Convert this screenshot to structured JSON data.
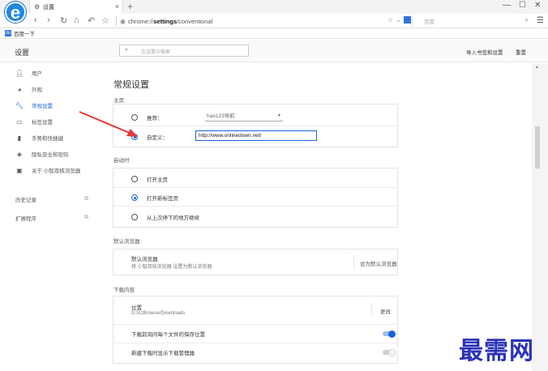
{
  "browser": {
    "tab_title": "设置",
    "new_tab": "+",
    "url_prefix": "chrome://",
    "url_bold": "settings",
    "url_suffix": "/conventional",
    "search_placeholder": "百度",
    "bookmark_label": "百度一下",
    "window_controls": [
      "—",
      "☐",
      "✕"
    ]
  },
  "header": {
    "title": "设置",
    "search_placeholder": "在设置中搜索",
    "import_link": "导入书签和设置",
    "reset_link": "重置"
  },
  "sidebar": {
    "items": [
      {
        "label": "用户",
        "icon": "person-icon"
      },
      {
        "label": "外观",
        "icon": "palette-icon"
      },
      {
        "label": "常规设置",
        "icon": "wrench-icon",
        "active": true
      },
      {
        "label": "标签设置",
        "icon": "tab-icon"
      },
      {
        "label": "手势和快捷键",
        "icon": "mouse-icon"
      },
      {
        "label": "隐私安全和密码",
        "icon": "shield-icon"
      },
      {
        "label": "关于 小智双核浏览器",
        "icon": "info-icon"
      }
    ],
    "links": [
      {
        "label": "历史记录"
      },
      {
        "label": "扩展程序"
      }
    ]
  },
  "main": {
    "title": "常规设置",
    "homepage": {
      "section": "主页",
      "recommend_label": "推荐：",
      "recommend_value": "hao123导航",
      "custom_label": "自定义：",
      "custom_value": "http://www.onlinedown.net/"
    },
    "startup": {
      "section": "启动时",
      "options": [
        "打开主页",
        "打开新标签页",
        "从上次停下的地方继续"
      ],
      "selected": 1
    },
    "default_browser": {
      "section": "默认浏览器",
      "title": "默认浏览器",
      "subtitle": "将 小智双核浏览器 设置为默认浏览器",
      "action": "设为默认浏览器"
    },
    "downloads": {
      "section": "下载内容",
      "location_title": "位置",
      "location_path": "D:\\XzBrowserDownloads",
      "change": "更改",
      "ask_label": "下载前询问每个文件的保存位置",
      "ask_on": true,
      "show_manager_label": "新建下载时显示下载管理器",
      "show_manager_on": false
    }
  },
  "watermark": "最需网",
  "colors": {
    "accent": "#1a64d6",
    "annotation_arrow": "#e53935",
    "watermark": "#2a33b8"
  }
}
